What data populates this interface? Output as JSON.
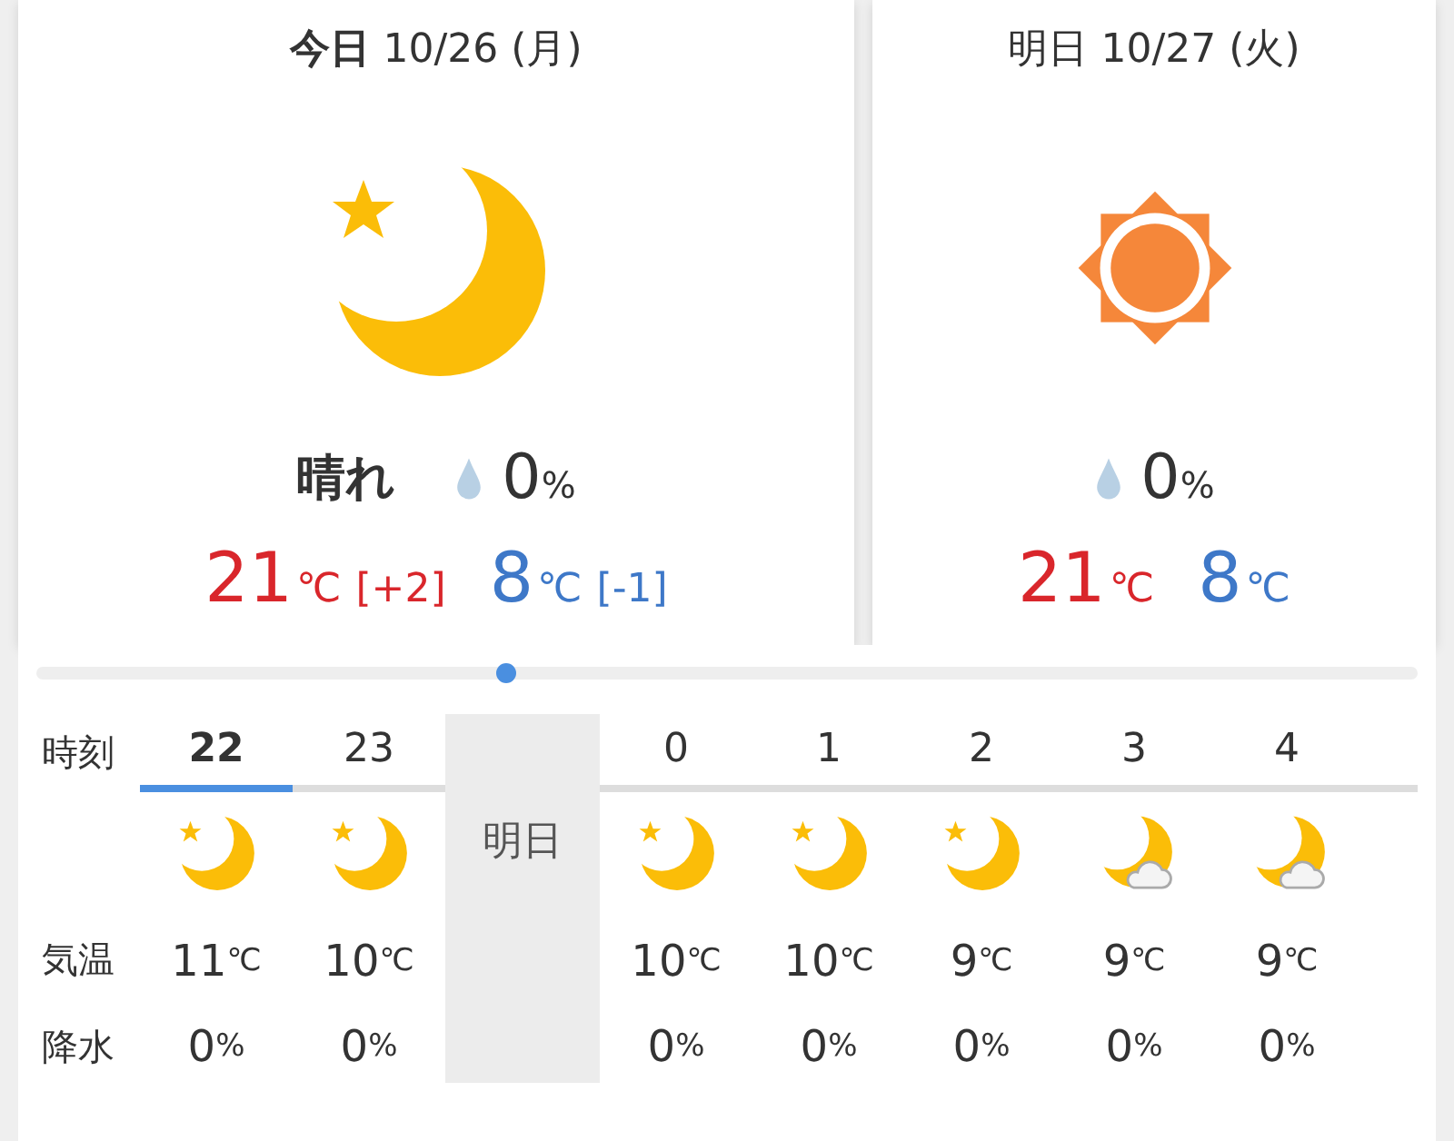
{
  "days": [
    {
      "heading": "**今日** 10/26 (月)",
      "kind": "clear-night",
      "weather": "晴れ",
      "rain": "0",
      "rain_unit": "%",
      "high": "21",
      "high_unit": "℃",
      "high_diff": "[+2]",
      "low": "8",
      "low_unit": "℃",
      "low_diff": "[-1]"
    },
    {
      "heading": "明日 10/27 (火)",
      "kind": "sunny",
      "rain": "0",
      "rain_unit": "%",
      "high": "21",
      "high_unit": "℃",
      "low": "8",
      "low_unit": "℃"
    }
  ],
  "timeline": {
    "level": 0.34
  },
  "hourly": {
    "row_labels": [
      "時刻",
      "気温",
      "降水"
    ],
    "columns": [
      {
        "kind": "clear-night",
        "hour": "22",
        "selected": true,
        "temp": "11",
        "temp_unit": "℃",
        "precip": "0",
        "precip_unit": "%"
      },
      {
        "kind": "clear-night",
        "hour": "23",
        "selected": false,
        "temp": "10",
        "temp_unit": "℃",
        "precip": "0",
        "precip_unit": "%"
      },
      {
        "kind": "day-break",
        "label": "明日"
      },
      {
        "kind": "clear-night",
        "hour": "0",
        "selected": false,
        "temp": "10",
        "temp_unit": "℃",
        "precip": "0",
        "precip_unit": "%"
      },
      {
        "kind": "clear-night",
        "hour": "1",
        "selected": false,
        "temp": "10",
        "temp_unit": "℃",
        "precip": "0",
        "precip_unit": "%"
      },
      {
        "kind": "clear-night",
        "hour": "2",
        "selected": false,
        "temp": "9",
        "temp_unit": "℃",
        "precip": "0",
        "precip_unit": "%"
      },
      {
        "kind": "cloudy-night",
        "hour": "3",
        "selected": false,
        "temp": "9",
        "temp_unit": "℃",
        "precip": "0",
        "precip_unit": "%"
      },
      {
        "kind": "cloudy-night",
        "hour": "4",
        "selected": false,
        "temp": "9",
        "temp_unit": "℃",
        "precip": "0",
        "precip_unit": "%"
      }
    ]
  }
}
